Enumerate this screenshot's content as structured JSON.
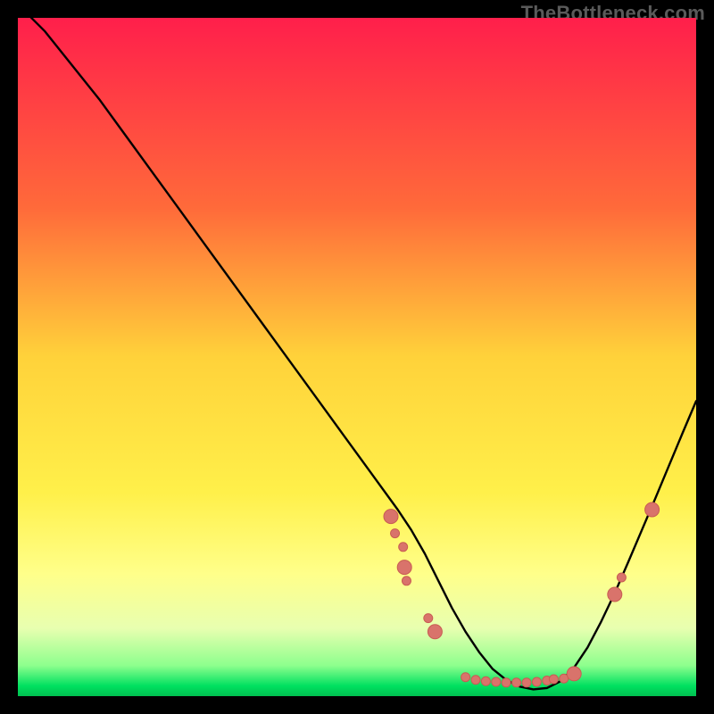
{
  "watermark": "TheBottleneck.com",
  "chart_data": {
    "type": "line",
    "title": "",
    "xlabel": "",
    "ylabel": "",
    "xlim": [
      0,
      100
    ],
    "ylim": [
      0,
      100
    ],
    "gradient_stops": [
      {
        "offset": 0,
        "color": "#ff1f4b"
      },
      {
        "offset": 0.28,
        "color": "#ff6a3a"
      },
      {
        "offset": 0.5,
        "color": "#ffd23a"
      },
      {
        "offset": 0.7,
        "color": "#fff04a"
      },
      {
        "offset": 0.82,
        "color": "#ffff8a"
      },
      {
        "offset": 0.9,
        "color": "#e8ffb0"
      },
      {
        "offset": 0.955,
        "color": "#8dff8d"
      },
      {
        "offset": 0.985,
        "color": "#00e060"
      },
      {
        "offset": 1.0,
        "color": "#00c050"
      }
    ],
    "series": [
      {
        "name": "bottleneck-curve",
        "color": "#000000",
        "width": 2.4,
        "x": [
          0,
          4,
          8,
          12,
          16,
          20,
          24,
          28,
          32,
          36,
          40,
          44,
          48,
          52,
          56,
          58,
          60,
          62,
          64,
          66,
          68,
          70,
          72,
          74,
          76,
          78,
          80,
          82,
          84,
          86,
          88,
          90,
          92,
          94,
          96,
          98,
          100
        ],
        "y": [
          102,
          98,
          93,
          88,
          82.5,
          77,
          71.5,
          66,
          60.5,
          55,
          49.5,
          44,
          38.5,
          33,
          27.5,
          24.5,
          21,
          17,
          13,
          9.5,
          6.5,
          4,
          2.4,
          1.4,
          1.0,
          1.2,
          2.2,
          4.2,
          7.2,
          11,
          15.2,
          19.8,
          24.5,
          29.2,
          34,
          38.8,
          43.5
        ]
      }
    ],
    "markers": {
      "color": "#d9736b",
      "stroke": "#c85c53",
      "r_small": 5,
      "r_big": 8,
      "points": [
        {
          "x": 55.0,
          "y": 26.5,
          "r": "big"
        },
        {
          "x": 55.6,
          "y": 24.0,
          "r": "small"
        },
        {
          "x": 56.8,
          "y": 22.0,
          "r": "small"
        },
        {
          "x": 57.0,
          "y": 19.0,
          "r": "big"
        },
        {
          "x": 57.3,
          "y": 17.0,
          "r": "small"
        },
        {
          "x": 60.5,
          "y": 11.5,
          "r": "small"
        },
        {
          "x": 61.5,
          "y": 9.5,
          "r": "big"
        },
        {
          "x": 66.0,
          "y": 2.8,
          "r": "small"
        },
        {
          "x": 67.5,
          "y": 2.4,
          "r": "small"
        },
        {
          "x": 69.0,
          "y": 2.2,
          "r": "small"
        },
        {
          "x": 70.5,
          "y": 2.1,
          "r": "small"
        },
        {
          "x": 72.0,
          "y": 2.0,
          "r": "small"
        },
        {
          "x": 73.5,
          "y": 2.0,
          "r": "small"
        },
        {
          "x": 75.0,
          "y": 2.0,
          "r": "small"
        },
        {
          "x": 76.5,
          "y": 2.1,
          "r": "small"
        },
        {
          "x": 78.0,
          "y": 2.3,
          "r": "small"
        },
        {
          "x": 79.0,
          "y": 2.5,
          "r": "small"
        },
        {
          "x": 80.5,
          "y": 2.6,
          "r": "small"
        },
        {
          "x": 82.0,
          "y": 3.3,
          "r": "big"
        },
        {
          "x": 88.0,
          "y": 15.0,
          "r": "big"
        },
        {
          "x": 89.0,
          "y": 17.5,
          "r": "small"
        },
        {
          "x": 93.5,
          "y": 27.5,
          "r": "big"
        }
      ]
    }
  }
}
